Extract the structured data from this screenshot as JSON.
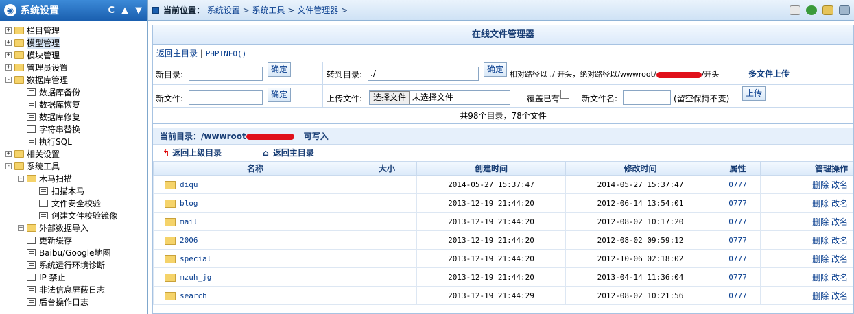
{
  "left": {
    "title": "系统设置",
    "ctrl": [
      "C",
      "▲",
      "▼"
    ],
    "items": [
      {
        "label": "栏目管理",
        "type": "folder",
        "pm": "+",
        "lvl": 0
      },
      {
        "label": "模型管理",
        "type": "folder",
        "pm": "+",
        "lvl": 0,
        "sel": true
      },
      {
        "label": "模块管理",
        "type": "folder",
        "pm": "+",
        "lvl": 0
      },
      {
        "label": "管理员设置",
        "type": "folder",
        "pm": "+",
        "lvl": 0
      },
      {
        "label": "数据库管理",
        "type": "folder",
        "pm": "-",
        "lvl": 0
      },
      {
        "label": "数据库备份",
        "type": "doc",
        "lvl": 1
      },
      {
        "label": "数据库恢复",
        "type": "doc",
        "lvl": 1
      },
      {
        "label": "数据库修复",
        "type": "doc",
        "lvl": 1
      },
      {
        "label": "字符串替换",
        "type": "doc",
        "lvl": 1
      },
      {
        "label": "执行SQL",
        "type": "doc",
        "lvl": 1
      },
      {
        "label": "相关设置",
        "type": "folder",
        "pm": "+",
        "lvl": 0
      },
      {
        "label": "系统工具",
        "type": "folder",
        "pm": "-",
        "lvl": 0
      },
      {
        "label": "木马扫描",
        "type": "folder",
        "pm": "-",
        "lvl": 1
      },
      {
        "label": "扫描木马",
        "type": "doc",
        "lvl": 2
      },
      {
        "label": "文件安全校验",
        "type": "doc",
        "lvl": 2
      },
      {
        "label": "创建文件校验镜像",
        "type": "doc",
        "lvl": 2
      },
      {
        "label": "外部数据导入",
        "type": "folder",
        "pm": "+",
        "lvl": 1
      },
      {
        "label": "更新缓存",
        "type": "doc",
        "lvl": 1
      },
      {
        "label": "Baibu/Google地图",
        "type": "doc",
        "lvl": 1
      },
      {
        "label": "系统运行环境诊断",
        "type": "doc",
        "lvl": 1
      },
      {
        "label": "IP 禁止",
        "type": "doc",
        "lvl": 1
      },
      {
        "label": "非法信息屏蔽日志",
        "type": "doc",
        "lvl": 1
      },
      {
        "label": "后台操作日志",
        "type": "doc",
        "lvl": 1
      }
    ]
  },
  "top": {
    "prefix": "当前位置：",
    "crumbs": [
      "系统设置",
      "系统工具",
      "文件管理器"
    ],
    "sep": " > ",
    "tail": " >"
  },
  "main": {
    "title": "在线文件管理器",
    "link_home": "返回主目录",
    "link_sep": " | ",
    "link_php": "PHPINFO()",
    "newdir_label": "新目录:",
    "confirm": "确定",
    "goto_label": "转到目录:",
    "goto_value": "./",
    "path_hint": "相对路径以 ./ 开头，绝对路径以/wwwroot/",
    "path_hint_end": "/开头",
    "multi_upload": "多文件上传",
    "newfile_label": "新文件:",
    "upload_label": "上传文件:",
    "choose_file": "选择文件",
    "no_file": "未选择文件",
    "overwrite": "覆盖已有",
    "newname_label": "新文件名:",
    "newname_hint": "(留空保持不变)",
    "upload_btn": "上传",
    "count": "共98个目录，78个文件",
    "curdir_label": "当前目录：/wwwroot",
    "writable": "可写入",
    "nav_up": "返回上级目录",
    "nav_home": "返回主目录",
    "headers": [
      "名称",
      "大小",
      "创建时间",
      "修改时间",
      "属性",
      "管理操作"
    ],
    "op_del": "删除",
    "op_ren": "改名",
    "rows": [
      {
        "name": "diqu",
        "ctime": "2014-05-27 15:37:47",
        "mtime": "2014-05-27 15:37:47",
        "attr": "0777"
      },
      {
        "name": "blog",
        "ctime": "2013-12-19 21:44:20",
        "mtime": "2012-06-14 13:54:01",
        "attr": "0777"
      },
      {
        "name": "mail",
        "ctime": "2013-12-19 21:44:20",
        "mtime": "2012-08-02 10:17:20",
        "attr": "0777"
      },
      {
        "name": "2006",
        "ctime": "2013-12-19 21:44:20",
        "mtime": "2012-08-02 09:59:12",
        "attr": "0777"
      },
      {
        "name": "special",
        "ctime": "2013-12-19 21:44:20",
        "mtime": "2012-10-06 02:18:02",
        "attr": "0777"
      },
      {
        "name": "mzuh_jg",
        "ctime": "2013-12-19 21:44:20",
        "mtime": "2013-04-14 11:36:04",
        "attr": "0777"
      },
      {
        "name": "search",
        "ctime": "2013-12-19 21:44:29",
        "mtime": "2012-08-02 10:21:56",
        "attr": "0777"
      }
    ]
  }
}
